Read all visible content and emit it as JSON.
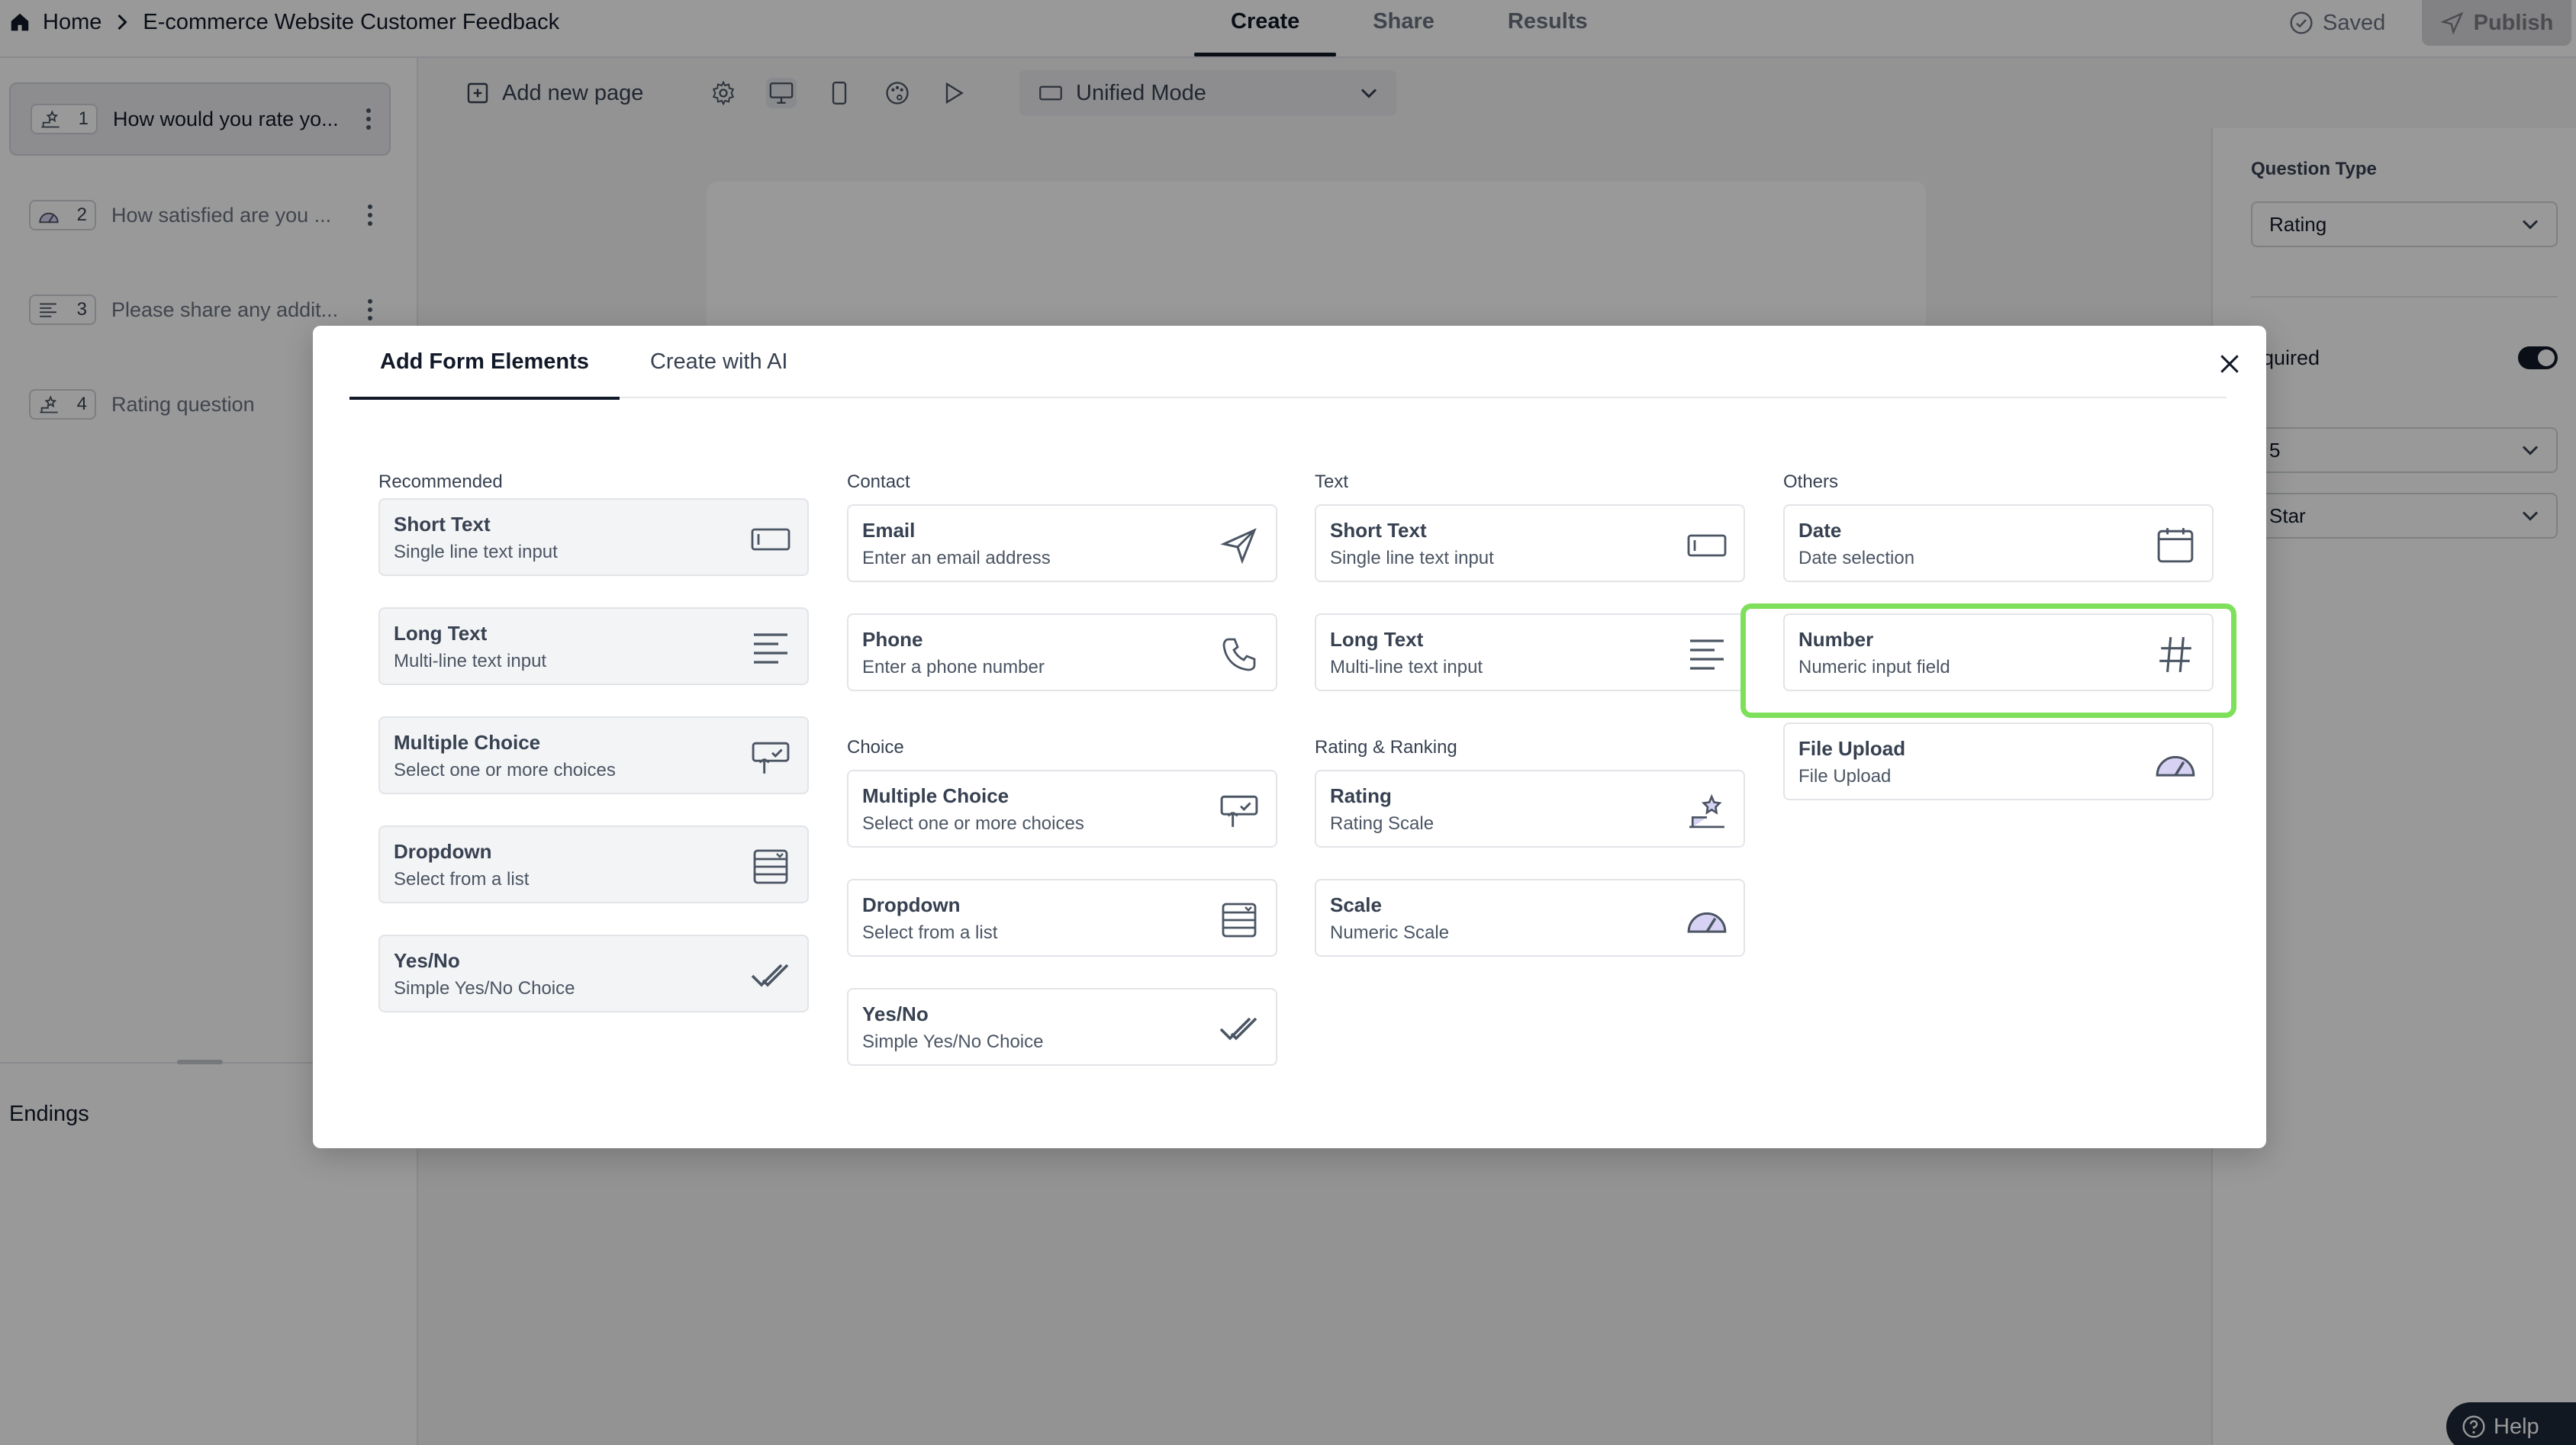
{
  "breadcrumb": {
    "home": "Home",
    "form_title": "E-commerce Website Customer Feedback"
  },
  "top_tabs": [
    "Create",
    "Share",
    "Results"
  ],
  "status": {
    "saved": "Saved",
    "publish": "Publish"
  },
  "sidebar": {
    "questions": [
      {
        "num": "1",
        "text": "How would you rate yo...",
        "icon": "rating-icon"
      },
      {
        "num": "2",
        "text": "How satisfied are you ...",
        "icon": "scale-icon"
      },
      {
        "num": "3",
        "text": "Please share any addit...",
        "icon": "long-text-icon"
      },
      {
        "num": "4",
        "text": "Rating question",
        "icon": "rating-icon"
      }
    ],
    "endings": "Endings"
  },
  "toolbar": {
    "add_page": "Add new page",
    "mode": "Unified Mode"
  },
  "right_panel": {
    "question_type_label": "Question Type",
    "question_type_value": "Rating",
    "required_label": "equired",
    "scale_value": "5",
    "shape_value": "Star"
  },
  "help": "Help",
  "modal": {
    "tabs": [
      "Add Form Elements",
      "Create with AI"
    ],
    "columns": [
      {
        "title": "Recommended",
        "items": [
          {
            "title": "Short Text",
            "desc": "Single line text input",
            "icon": "short-text-icon"
          },
          {
            "title": "Long Text",
            "desc": "Multi-line text input",
            "icon": "long-text-icon"
          },
          {
            "title": "Multiple Choice",
            "desc": "Select one or more choices",
            "icon": "multiple-choice-icon"
          },
          {
            "title": "Dropdown",
            "desc": "Select from a list",
            "icon": "dropdown-icon"
          },
          {
            "title": "Yes/No",
            "desc": "Simple Yes/No Choice",
            "icon": "yes-no-icon"
          }
        ]
      },
      {
        "title": "Contact",
        "items": [
          {
            "title": "Email",
            "desc": "Enter an email address",
            "icon": "email-icon"
          },
          {
            "title": "Phone",
            "desc": "Enter a phone number",
            "icon": "phone-icon"
          }
        ],
        "subtitle": "Choice",
        "subitems": [
          {
            "title": "Multiple Choice",
            "desc": "Select one or more choices",
            "icon": "multiple-choice-icon"
          },
          {
            "title": "Dropdown",
            "desc": "Select from a list",
            "icon": "dropdown-icon"
          },
          {
            "title": "Yes/No",
            "desc": "Simple Yes/No Choice",
            "icon": "yes-no-icon"
          }
        ]
      },
      {
        "title": "Text",
        "items": [
          {
            "title": "Short Text",
            "desc": "Single line text input",
            "icon": "short-text-icon"
          },
          {
            "title": "Long Text",
            "desc": "Multi-line text input",
            "icon": "long-text-icon"
          }
        ],
        "subtitle": "Rating & Ranking",
        "subitems": [
          {
            "title": "Rating",
            "desc": "Rating Scale",
            "icon": "rating-icon"
          },
          {
            "title": "Scale",
            "desc": "Numeric Scale",
            "icon": "scale-icon"
          }
        ]
      },
      {
        "title": "Others",
        "items": [
          {
            "title": "Date",
            "desc": "Date selection",
            "icon": "calendar-icon"
          },
          {
            "title": "Number",
            "desc": "Numeric input field",
            "icon": "hash-icon"
          },
          {
            "title": "File Upload",
            "desc": "File Upload",
            "icon": "scale-icon"
          }
        ]
      }
    ],
    "highlight_color": "#7ee05a"
  }
}
